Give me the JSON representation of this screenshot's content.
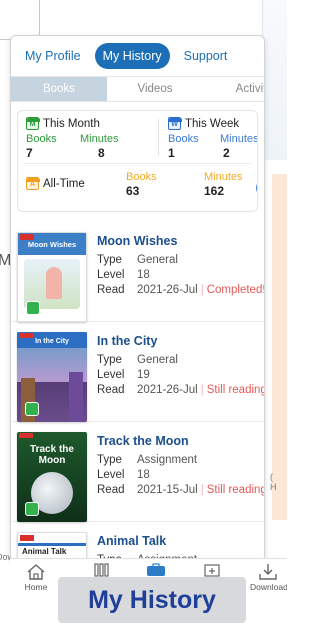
{
  "background": {
    "left_fragment": "Ma",
    "right_fragment": "H",
    "left_bottom_text": "Dow",
    "right_bottom_text": "("
  },
  "nav": {
    "tabs": [
      "My Profile",
      "My History",
      "Support"
    ],
    "active": "My History"
  },
  "subtabs": {
    "items": [
      "Books",
      "Videos",
      "Activit"
    ],
    "active": "Books"
  },
  "stats": {
    "month": {
      "label": "This Month",
      "icon_letter": "M",
      "books_label": "Books",
      "books": "7",
      "minutes_label": "Minutes",
      "minutes": "8"
    },
    "week": {
      "label": "This Week",
      "icon_letter": "W",
      "books_label": "Books",
      "books": "1",
      "minutes_label": "Minutes",
      "minutes": "2"
    },
    "alltime": {
      "label": "All-Time",
      "icon_letter": "A",
      "books_label": "Books",
      "books": "63",
      "minutes_label": "Minutes",
      "minutes": "162"
    }
  },
  "field_labels": {
    "type": "Type",
    "level": "Level",
    "read": "Read"
  },
  "books": [
    {
      "title": "Moon Wishes",
      "type": "General",
      "level": "18",
      "read_date": "2021-26-Jul",
      "status": "Completed!",
      "cover_text": "Moon Wishes"
    },
    {
      "title": "In the City",
      "type": "General",
      "level": "19",
      "read_date": "2021-26-Jul",
      "status": "Still reading",
      "cover_text": "In the City"
    },
    {
      "title": "Track the Moon",
      "type": "Assignment",
      "level": "18",
      "read_date": "2021-15-Jul",
      "status": "Still reading",
      "cover_text": "Track the Moon"
    },
    {
      "title": "Animal Talk",
      "type": "Assignment",
      "level": "",
      "read_date": "",
      "status": "",
      "cover_text": "Animal Talk"
    }
  ],
  "bottom_nav": {
    "home": "Home",
    "download": "Download"
  },
  "banner": "My History",
  "colors": {
    "brand_blue": "#1c6fb6",
    "title_navy": "#1c4f8c",
    "status_red": "#e25a57",
    "month_green": "#2e9b3b",
    "week_blue": "#2a6fcf",
    "alltime_orange": "#f0a020"
  }
}
